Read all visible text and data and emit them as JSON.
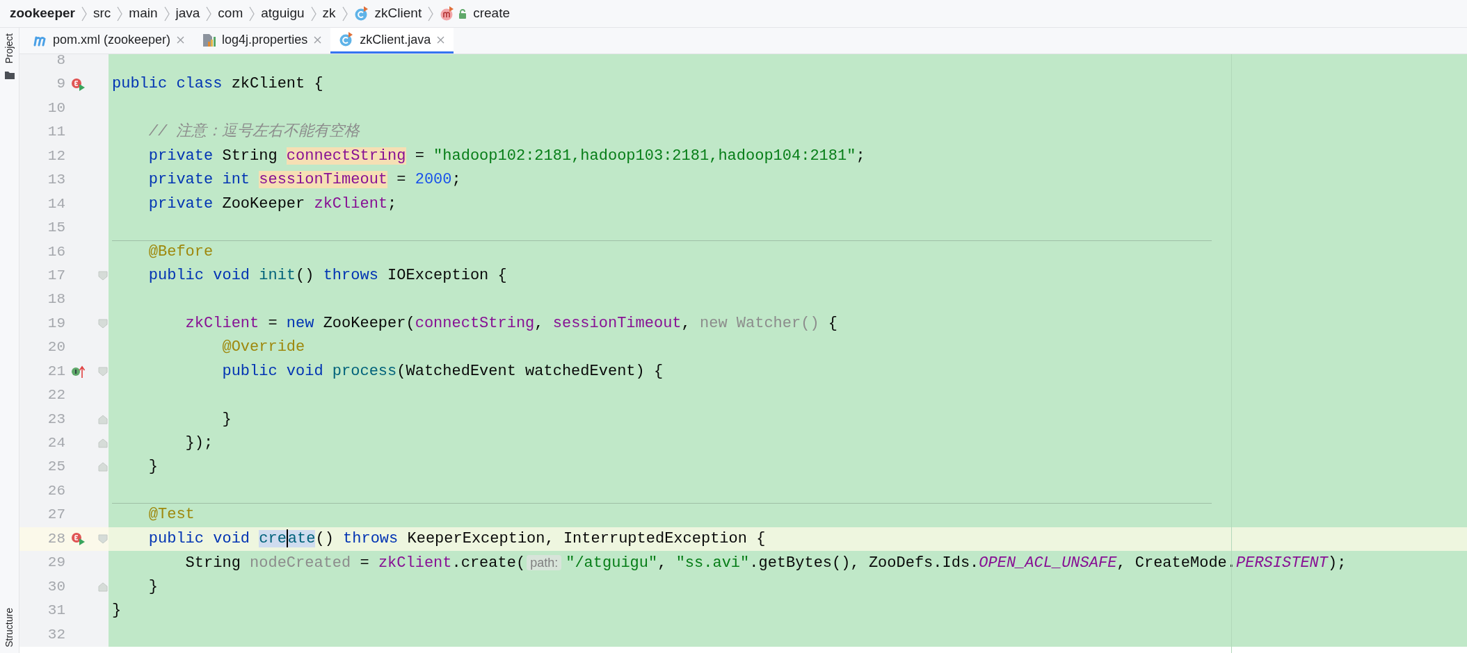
{
  "breadcrumb": [
    {
      "label": "zookeeper",
      "bold": true
    },
    {
      "label": "src",
      "bold": false
    },
    {
      "label": "main",
      "bold": false
    },
    {
      "label": "java",
      "bold": false
    },
    {
      "label": "com",
      "bold": false
    },
    {
      "label": "atguigu",
      "bold": false
    },
    {
      "label": "zk",
      "bold": false
    },
    {
      "label": "zkClient",
      "bold": false,
      "kind": "class"
    },
    {
      "label": "create",
      "bold": false,
      "kind": "method"
    }
  ],
  "side_tools": {
    "top": "Project",
    "bottom": "Structure"
  },
  "tabs": [
    {
      "label": "pom.xml (zookeeper)",
      "kind": "maven",
      "selected": false
    },
    {
      "label": "log4j.properties",
      "kind": "properties",
      "selected": false
    },
    {
      "label": "zkClient.java",
      "kind": "class",
      "selected": true
    }
  ],
  "lines": [
    {
      "number": "8"
    },
    {
      "number": "9",
      "gutter_marker": {
        "kind": "run"
      },
      "tokens": [
        {
          "t": "public class",
          "kind": "kw"
        },
        {
          "t": " zkClient {",
          "kind": "plain"
        }
      ]
    },
    {
      "number": "10"
    },
    {
      "number": "11",
      "tokens": [
        {
          "t": "    // 注意：逗号左右不能有空格",
          "kind": "comment"
        }
      ]
    },
    {
      "number": "12",
      "tokens": [
        {
          "t": "    private",
          "kind": "kw"
        },
        {
          "t": " String ",
          "kind": "plain"
        },
        {
          "t": "connectString",
          "kind": "field",
          "usage_highlight": true
        },
        {
          "t": " = ",
          "kind": "plain"
        },
        {
          "t": "\"hadoop102:2181,hadoop103:2181,hadoop104:2181\"",
          "kind": "str"
        },
        {
          "t": ";",
          "kind": "plain"
        }
      ]
    },
    {
      "number": "13",
      "tokens": [
        {
          "t": "    private int ",
          "kind": "kw"
        },
        {
          "t": "sessionTimeout",
          "kind": "field",
          "usage_highlight": true
        },
        {
          "t": " = ",
          "kind": "plain"
        },
        {
          "t": "2000",
          "kind": "num"
        },
        {
          "t": ";",
          "kind": "plain"
        }
      ]
    },
    {
      "number": "14",
      "tokens": [
        {
          "t": "    private",
          "kind": "kw"
        },
        {
          "t": " ZooKeeper ",
          "kind": "plain"
        },
        {
          "t": "zkClient",
          "kind": "field"
        },
        {
          "t": ";",
          "kind": "plain"
        }
      ]
    },
    {
      "number": "15"
    },
    {
      "number": "16",
      "separator_above": true,
      "tokens": [
        {
          "t": "    @Before",
          "kind": "annotation"
        }
      ]
    },
    {
      "number": "17",
      "fold": {
        "kind": "start"
      },
      "tokens": [
        {
          "t": "    public void ",
          "kind": "kw"
        },
        {
          "t": "init",
          "kind": "method"
        },
        {
          "t": "() ",
          "kind": "plain"
        },
        {
          "t": "throws",
          "kind": "kw"
        },
        {
          "t": " IOException {",
          "kind": "plain"
        }
      ]
    },
    {
      "number": "18"
    },
    {
      "number": "19",
      "fold": {
        "kind": "start"
      },
      "tokens": [
        {
          "t": "        zkClient",
          "kind": "field"
        },
        {
          "t": " = ",
          "kind": "plain"
        },
        {
          "t": "new",
          "kind": "kw"
        },
        {
          "t": " ZooKeeper(",
          "kind": "plain"
        },
        {
          "t": "connectString",
          "kind": "field"
        },
        {
          "t": ", ",
          "kind": "plain"
        },
        {
          "t": "sessionTimeout",
          "kind": "field"
        },
        {
          "t": ", ",
          "kind": "plain"
        },
        {
          "t": "new Watcher()",
          "kind": "grey"
        },
        {
          "t": " {",
          "kind": "plain"
        }
      ]
    },
    {
      "number": "20",
      "tokens": [
        {
          "t": "            @Override",
          "kind": "annotation"
        }
      ]
    },
    {
      "number": "21",
      "gutter_marker": {
        "kind": "implements"
      },
      "fold": {
        "kind": "start"
      },
      "tokens": [
        {
          "t": "            public void ",
          "kind": "kw"
        },
        {
          "t": "process",
          "kind": "method"
        },
        {
          "t": "(WatchedEvent watchedEvent) {",
          "kind": "plain"
        }
      ]
    },
    {
      "number": "22"
    },
    {
      "number": "23",
      "fold": {
        "kind": "end"
      },
      "tokens": [
        {
          "t": "            }",
          "kind": "plain"
        }
      ]
    },
    {
      "number": "24",
      "fold": {
        "kind": "end"
      },
      "tokens": [
        {
          "t": "        });",
          "kind": "plain"
        }
      ]
    },
    {
      "number": "25",
      "fold": {
        "kind": "end"
      },
      "tokens": [
        {
          "t": "    }",
          "kind": "plain"
        }
      ]
    },
    {
      "number": "26"
    },
    {
      "number": "27",
      "separator_above": true,
      "tokens": [
        {
          "t": "    @Test",
          "kind": "annotation"
        }
      ]
    },
    {
      "number": "28",
      "gutter_marker": {
        "kind": "run"
      },
      "fold": {
        "kind": "start"
      },
      "current": true,
      "tokens": [
        {
          "t": "    public void ",
          "kind": "kw"
        },
        {
          "t": "cre",
          "kind": "method",
          "text_selection": true,
          "caret": true
        },
        {
          "t": "ate",
          "kind": "method",
          "text_selection": true
        },
        {
          "t": "() ",
          "kind": "plain"
        },
        {
          "t": "throws",
          "kind": "kw"
        },
        {
          "t": " KeeperException, InterruptedException {",
          "kind": "plain"
        }
      ]
    },
    {
      "number": "29",
      "tokens": [
        {
          "t": "        String ",
          "kind": "plain"
        },
        {
          "t": "nodeCreated",
          "kind": "grey"
        },
        {
          "t": " = ",
          "kind": "plain"
        },
        {
          "t": "zkClient",
          "kind": "field"
        },
        {
          "t": ".create(",
          "kind": "plain"
        },
        {
          "t": "path:",
          "kind": "hint"
        },
        {
          "t": "\"/atguigu\"",
          "kind": "str"
        },
        {
          "t": ", ",
          "kind": "plain"
        },
        {
          "t": "\"ss.avi\"",
          "kind": "str"
        },
        {
          "t": ".getBytes(), ZooDefs.Ids.",
          "kind": "plain"
        },
        {
          "t": "OPEN_ACL_UNSAFE",
          "kind": "static"
        },
        {
          "t": ", CreateMode.",
          "kind": "plain"
        },
        {
          "t": "PERSISTENT",
          "kind": "static"
        },
        {
          "t": ");",
          "kind": "plain"
        }
      ]
    },
    {
      "number": "30",
      "fold": {
        "kind": "end"
      },
      "tokens": [
        {
          "t": "    }",
          "kind": "plain"
        }
      ]
    },
    {
      "number": "31",
      "tokens": [
        {
          "t": "}",
          "kind": "plain"
        }
      ]
    },
    {
      "number": "32"
    }
  ]
}
